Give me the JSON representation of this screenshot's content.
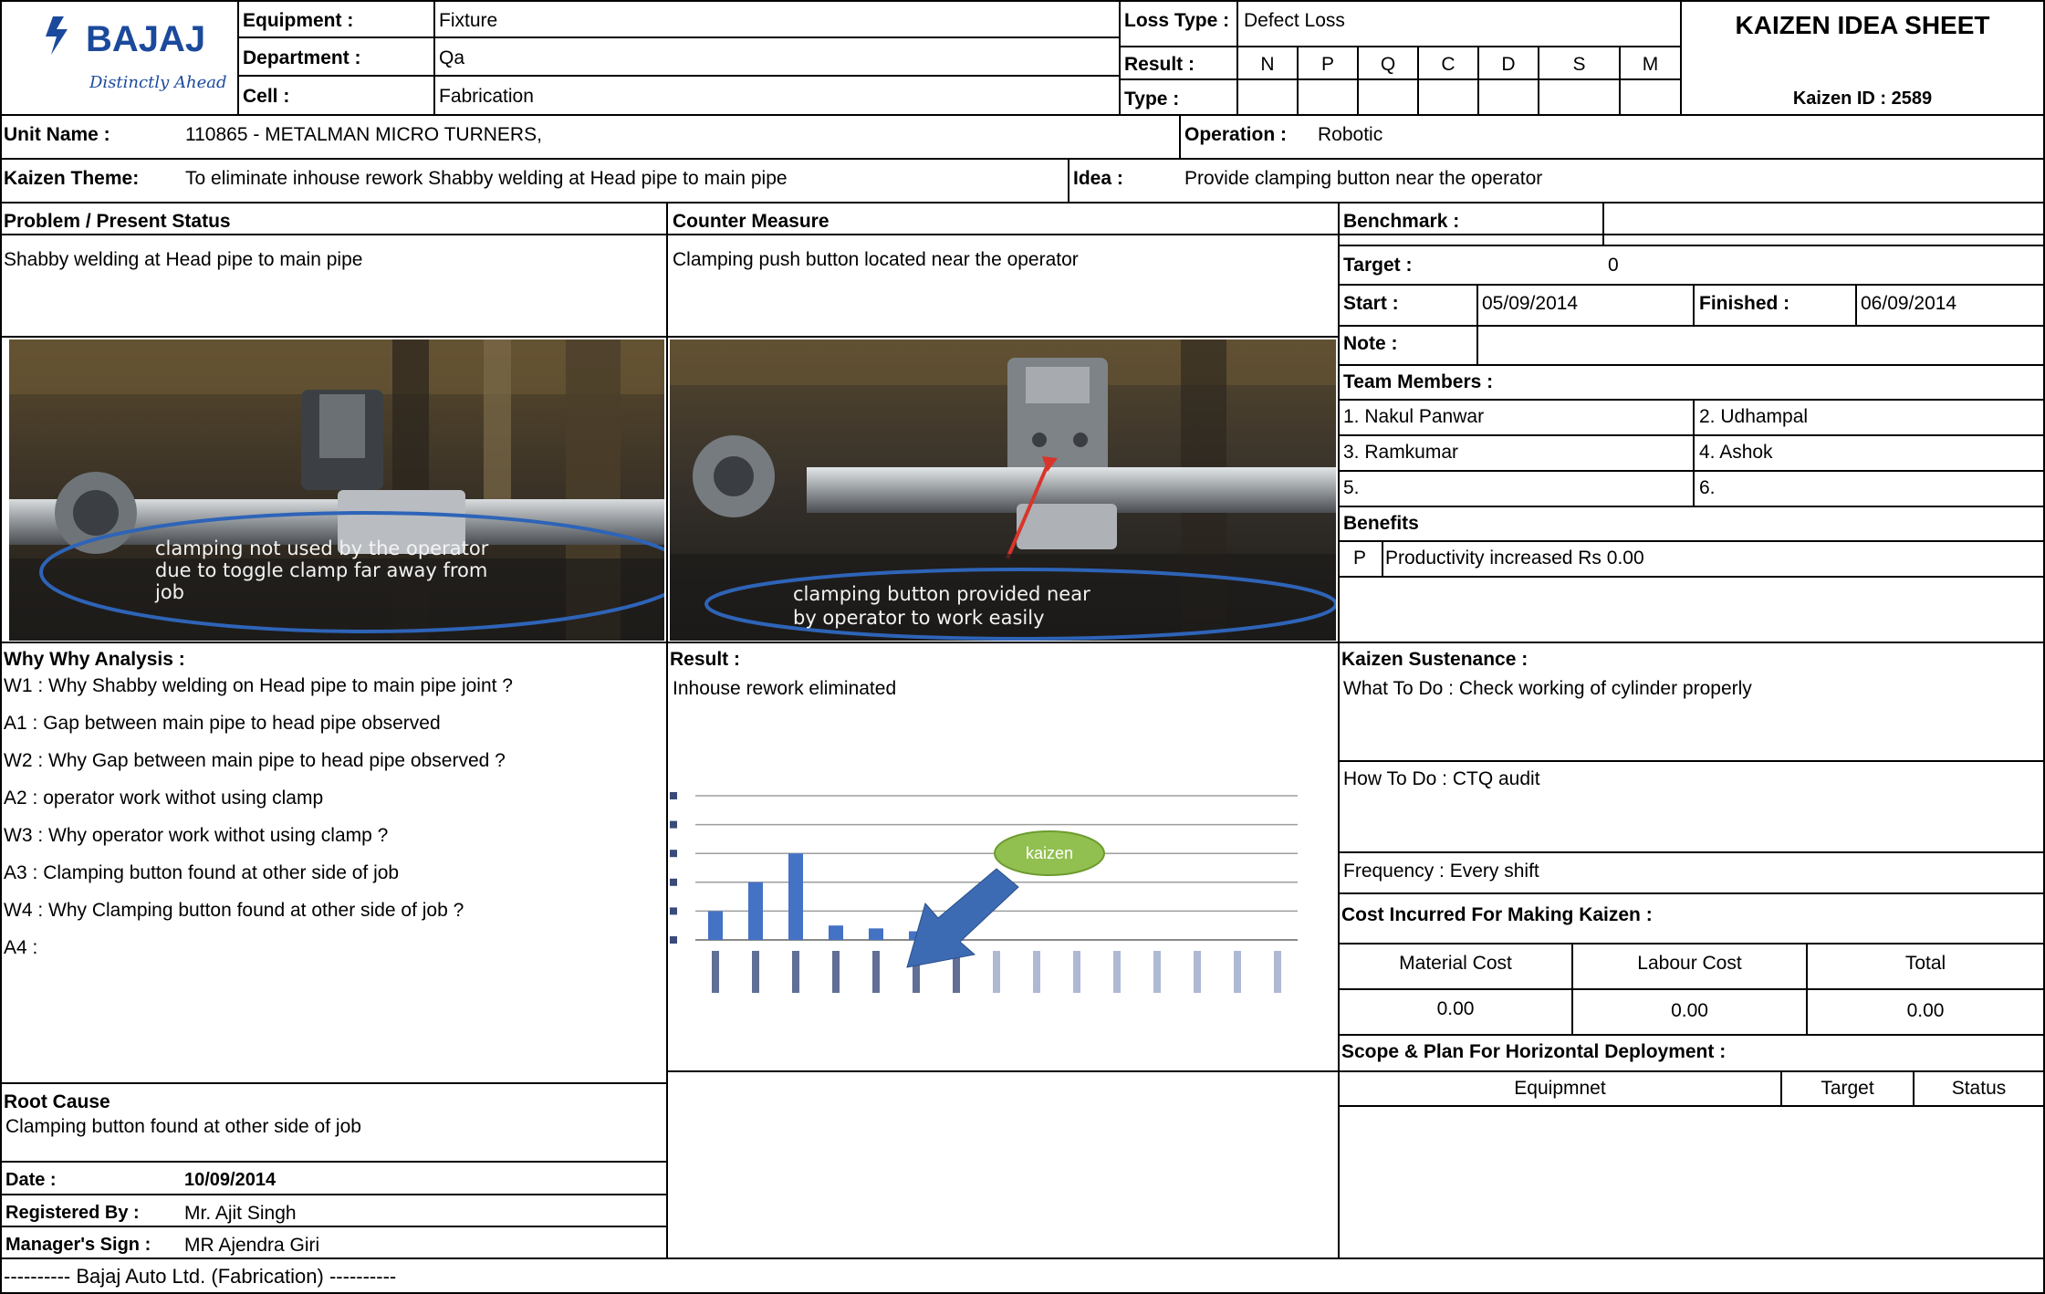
{
  "header": {
    "logo_text": "BAJAJ",
    "logo_tagline": "Distinctly Ahead",
    "equipment_label": "Equipment :",
    "equipment_value": "Fixture",
    "department_label": "Department :",
    "department_value": "Qa",
    "cell_label": "Cell :",
    "cell_value": "Fabrication",
    "loss_type_label": "Loss Type :",
    "loss_type_value": "Defect Loss",
    "result_label": "Result :",
    "type_label": "Type :",
    "result_columns": [
      "N",
      "P",
      "Q",
      "C",
      "D",
      "S",
      "M"
    ],
    "title": "KAIZEN IDEA SHEET",
    "kaizen_id": "Kaizen ID : 2589"
  },
  "unit": {
    "label": "Unit Name :",
    "value": "110865 - METALMAN MICRO TURNERS,",
    "operation_label": "Operation :",
    "operation_value": "Robotic"
  },
  "theme": {
    "label": "Kaizen Theme:",
    "value": "To eliminate inhouse rework Shabby welding at Head pipe to main pipe",
    "idea_label": "Idea :",
    "idea_value": "Provide clamping button near the operator"
  },
  "problem": {
    "heading": "Problem / Present Status",
    "text": "Shabby welding at Head pipe to main pipe",
    "photo_caption": [
      "clamping not used by the operator",
      "due to toggle clamp far away  from",
      "job"
    ]
  },
  "counter": {
    "heading": "Counter Measure",
    "text": "Clamping  push button located near the operator",
    "photo_caption": [
      "clamping button provided near",
      "by operator to work easily"
    ]
  },
  "side": {
    "benchmark_label": "Benchmark :",
    "benchmark_value": "",
    "target_label": "Target :",
    "target_value": "0",
    "start_label": "Start :",
    "start_value": "05/09/2014",
    "finished_label": "Finished :",
    "finished_value": "06/09/2014",
    "note_label": "Note :",
    "team_label": "Team Members :",
    "team": [
      "1. Nakul Panwar",
      "2. Udhampal",
      "3. Ramkumar",
      "4. Ashok",
      "5.",
      "6."
    ],
    "benefits_label": "Benefits",
    "benefit_code": "P",
    "benefit_text": "Productivity increased Rs 0.00"
  },
  "why": {
    "heading": "Why Why Analysis :",
    "lines": [
      "W1 : Why Shabby welding on Head pipe to main pipe joint ?",
      "A1 : Gap between main pipe to head pipe observed",
      "W2 : Why Gap between main pipe to head pipe observed ?",
      "A2 : operator work withot using clamp",
      "W3 : Why operator work withot using clamp ?",
      "A3 : Clamping button found at other side of job",
      "W4 : Why Clamping button found at other side of job ?",
      "A4 :"
    ]
  },
  "result": {
    "heading": "Result :",
    "text": "Inhouse rework eliminated",
    "kaizen_callout": "kaizen"
  },
  "chart_data": {
    "type": "bar",
    "values": [
      2,
      4,
      6,
      1,
      0.8,
      0.6,
      0.4,
      0,
      0,
      0,
      0,
      0,
      0,
      0,
      0
    ],
    "ylim": [
      0,
      10
    ],
    "grid": true
  },
  "sustenance": {
    "heading": "Kaizen Sustenance :",
    "what": "What To Do : Check working of cylinder properly",
    "how": "How To Do : CTQ audit",
    "frequency": "Frequency : Every shift"
  },
  "cost": {
    "heading": "Cost Incurred For Making Kaizen  :",
    "material_label": "Material Cost",
    "labour_label": "Labour Cost",
    "total_label": "Total",
    "material_value": "0.00",
    "labour_value": "0.00",
    "total_value": "0.00"
  },
  "scope": {
    "heading": "Scope & Plan For Horizontal Deployment :",
    "col_equipment": "Equipmnet",
    "col_target": "Target",
    "col_status": "Status"
  },
  "root": {
    "heading": "Root Cause",
    "text": "Clamping button found at other side of job"
  },
  "footer_info": {
    "date_label": "Date :",
    "date_value": "10/09/2014",
    "registered_label": "Registered By :",
    "registered_value": "Mr. Ajit Singh",
    "manager_label": "Manager's Sign :",
    "manager_value": "MR  Ajendra Giri",
    "footer_text": "---------- Bajaj Auto Ltd. (Fabrication)   ----------"
  },
  "colors": {
    "bar": "#4472c4",
    "callout": "#92c050",
    "arrow": "#3d6bb3",
    "grid": "#9e9e9e",
    "logo": "#1b4a9c"
  }
}
